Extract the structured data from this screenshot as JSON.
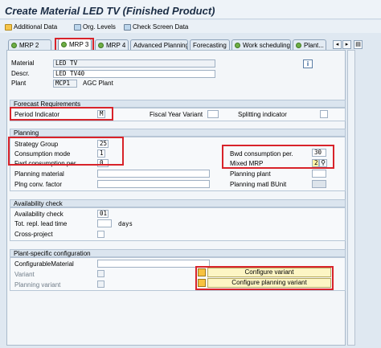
{
  "window": {
    "title": "Create Material LED TV (Finished Product)"
  },
  "toolbar": {
    "additional_data": "Additional Data",
    "org_levels": "Org. Levels",
    "check_screen_data": "Check Screen Data"
  },
  "tabs": [
    {
      "label": "MRP 2",
      "active": false,
      "checked": true
    },
    {
      "label": "MRP 3",
      "active": true,
      "checked": true
    },
    {
      "label": "MRP 4",
      "active": false,
      "checked": true
    },
    {
      "label": "Advanced Planning",
      "active": false,
      "checked": false
    },
    {
      "label": "Forecasting",
      "active": false,
      "checked": false
    },
    {
      "label": "Work scheduling",
      "active": false,
      "checked": true
    },
    {
      "label": "Plant...",
      "active": false,
      "checked": true
    }
  ],
  "header": {
    "material_label": "Material",
    "material_value": "LED TV",
    "descr_label": "Descr.",
    "descr_value": "LED TV40",
    "plant_label": "Plant",
    "plant_value": "MCP1",
    "plant_name": "AGC Plant"
  },
  "forecast": {
    "title": "Forecast Requirements",
    "period_indicator_label": "Period Indicator",
    "period_indicator_value": "M",
    "fiscal_year_variant_label": "Fiscal Year Variant",
    "splitting_indicator_label": "Splitting indicator"
  },
  "planning": {
    "title": "Planning",
    "strategy_group_label": "Strategy Group",
    "strategy_group_value": "25",
    "consumption_mode_label": "Consumption mode",
    "consumption_mode_value": "1",
    "fwd_consumption_label": "Fwd consumption per.",
    "fwd_consumption_value": "0",
    "bwd_consumption_label": "Bwd consumption per.",
    "bwd_consumption_value": "30",
    "mixed_mrp_label": "Mixed MRP",
    "mixed_mrp_value": "2",
    "planning_material_label": "Planning material",
    "planning_plant_label": "Planning plant",
    "plng_conv_factor_label": "Plng conv. factor",
    "planning_matl_bunit_label": "Planning matl BUnit"
  },
  "availability": {
    "title": "Availability check",
    "availability_check_label": "Availability check",
    "availability_check_value": "01",
    "tot_repl_lead_time_label": "Tot. repl. lead time",
    "tot_repl_lead_time_unit": "days",
    "cross_project_label": "Cross-project"
  },
  "plant_specific": {
    "title": "Plant-specific configuration",
    "configurable_material_label": "ConfigurableMaterial",
    "variant_label": "Variant",
    "planning_variant_label": "Planning variant",
    "configure_variant_button": "Configure variant",
    "configure_planning_variant_button": "Configure planning variant"
  },
  "icons": {
    "info": "i",
    "tab_left": "◂",
    "tab_right": "▸",
    "tab_list": "▤"
  }
}
